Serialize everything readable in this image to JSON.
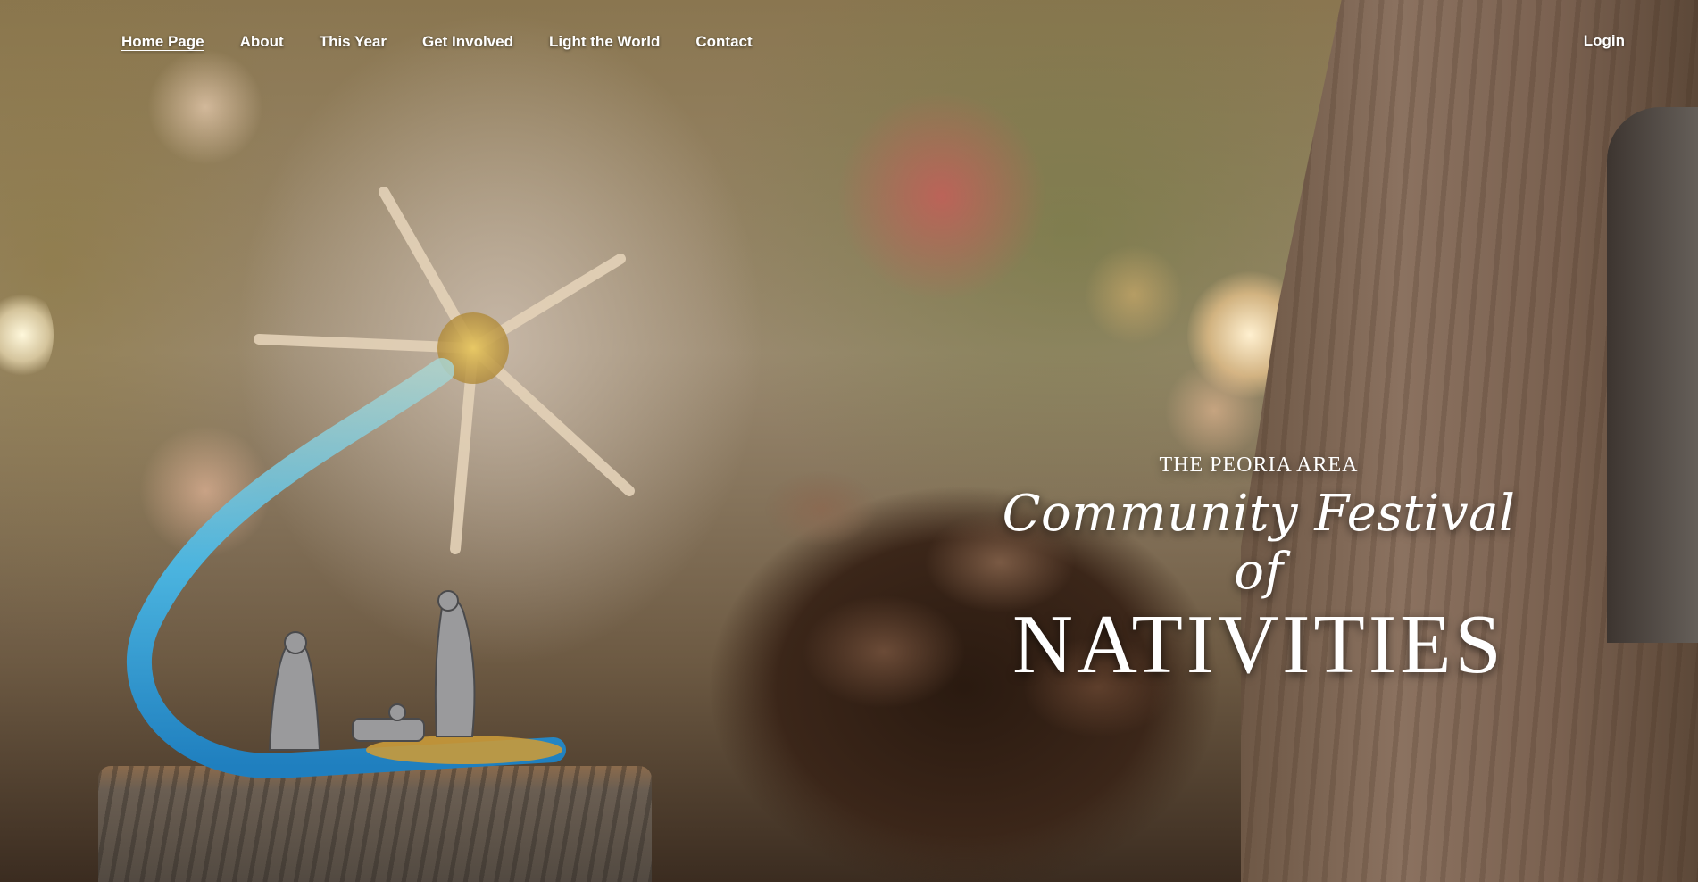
{
  "nav": {
    "items": [
      {
        "label": "Home Page",
        "active": true
      },
      {
        "label": "About"
      },
      {
        "label": "This Year"
      },
      {
        "label": "Get Involved"
      },
      {
        "label": "Light the World"
      },
      {
        "label": "Contact"
      }
    ],
    "login_label": "Login"
  },
  "hero": {
    "title_pre": "THE PEORIA AREA",
    "title_script": "Community Festival of",
    "title_main": "NATIVITIES"
  },
  "colors": {
    "nav_text": "#ffffff",
    "title_text": "#ffffff",
    "glass_blue": "#2aa7e0",
    "star_gold": "#d8b25a"
  }
}
